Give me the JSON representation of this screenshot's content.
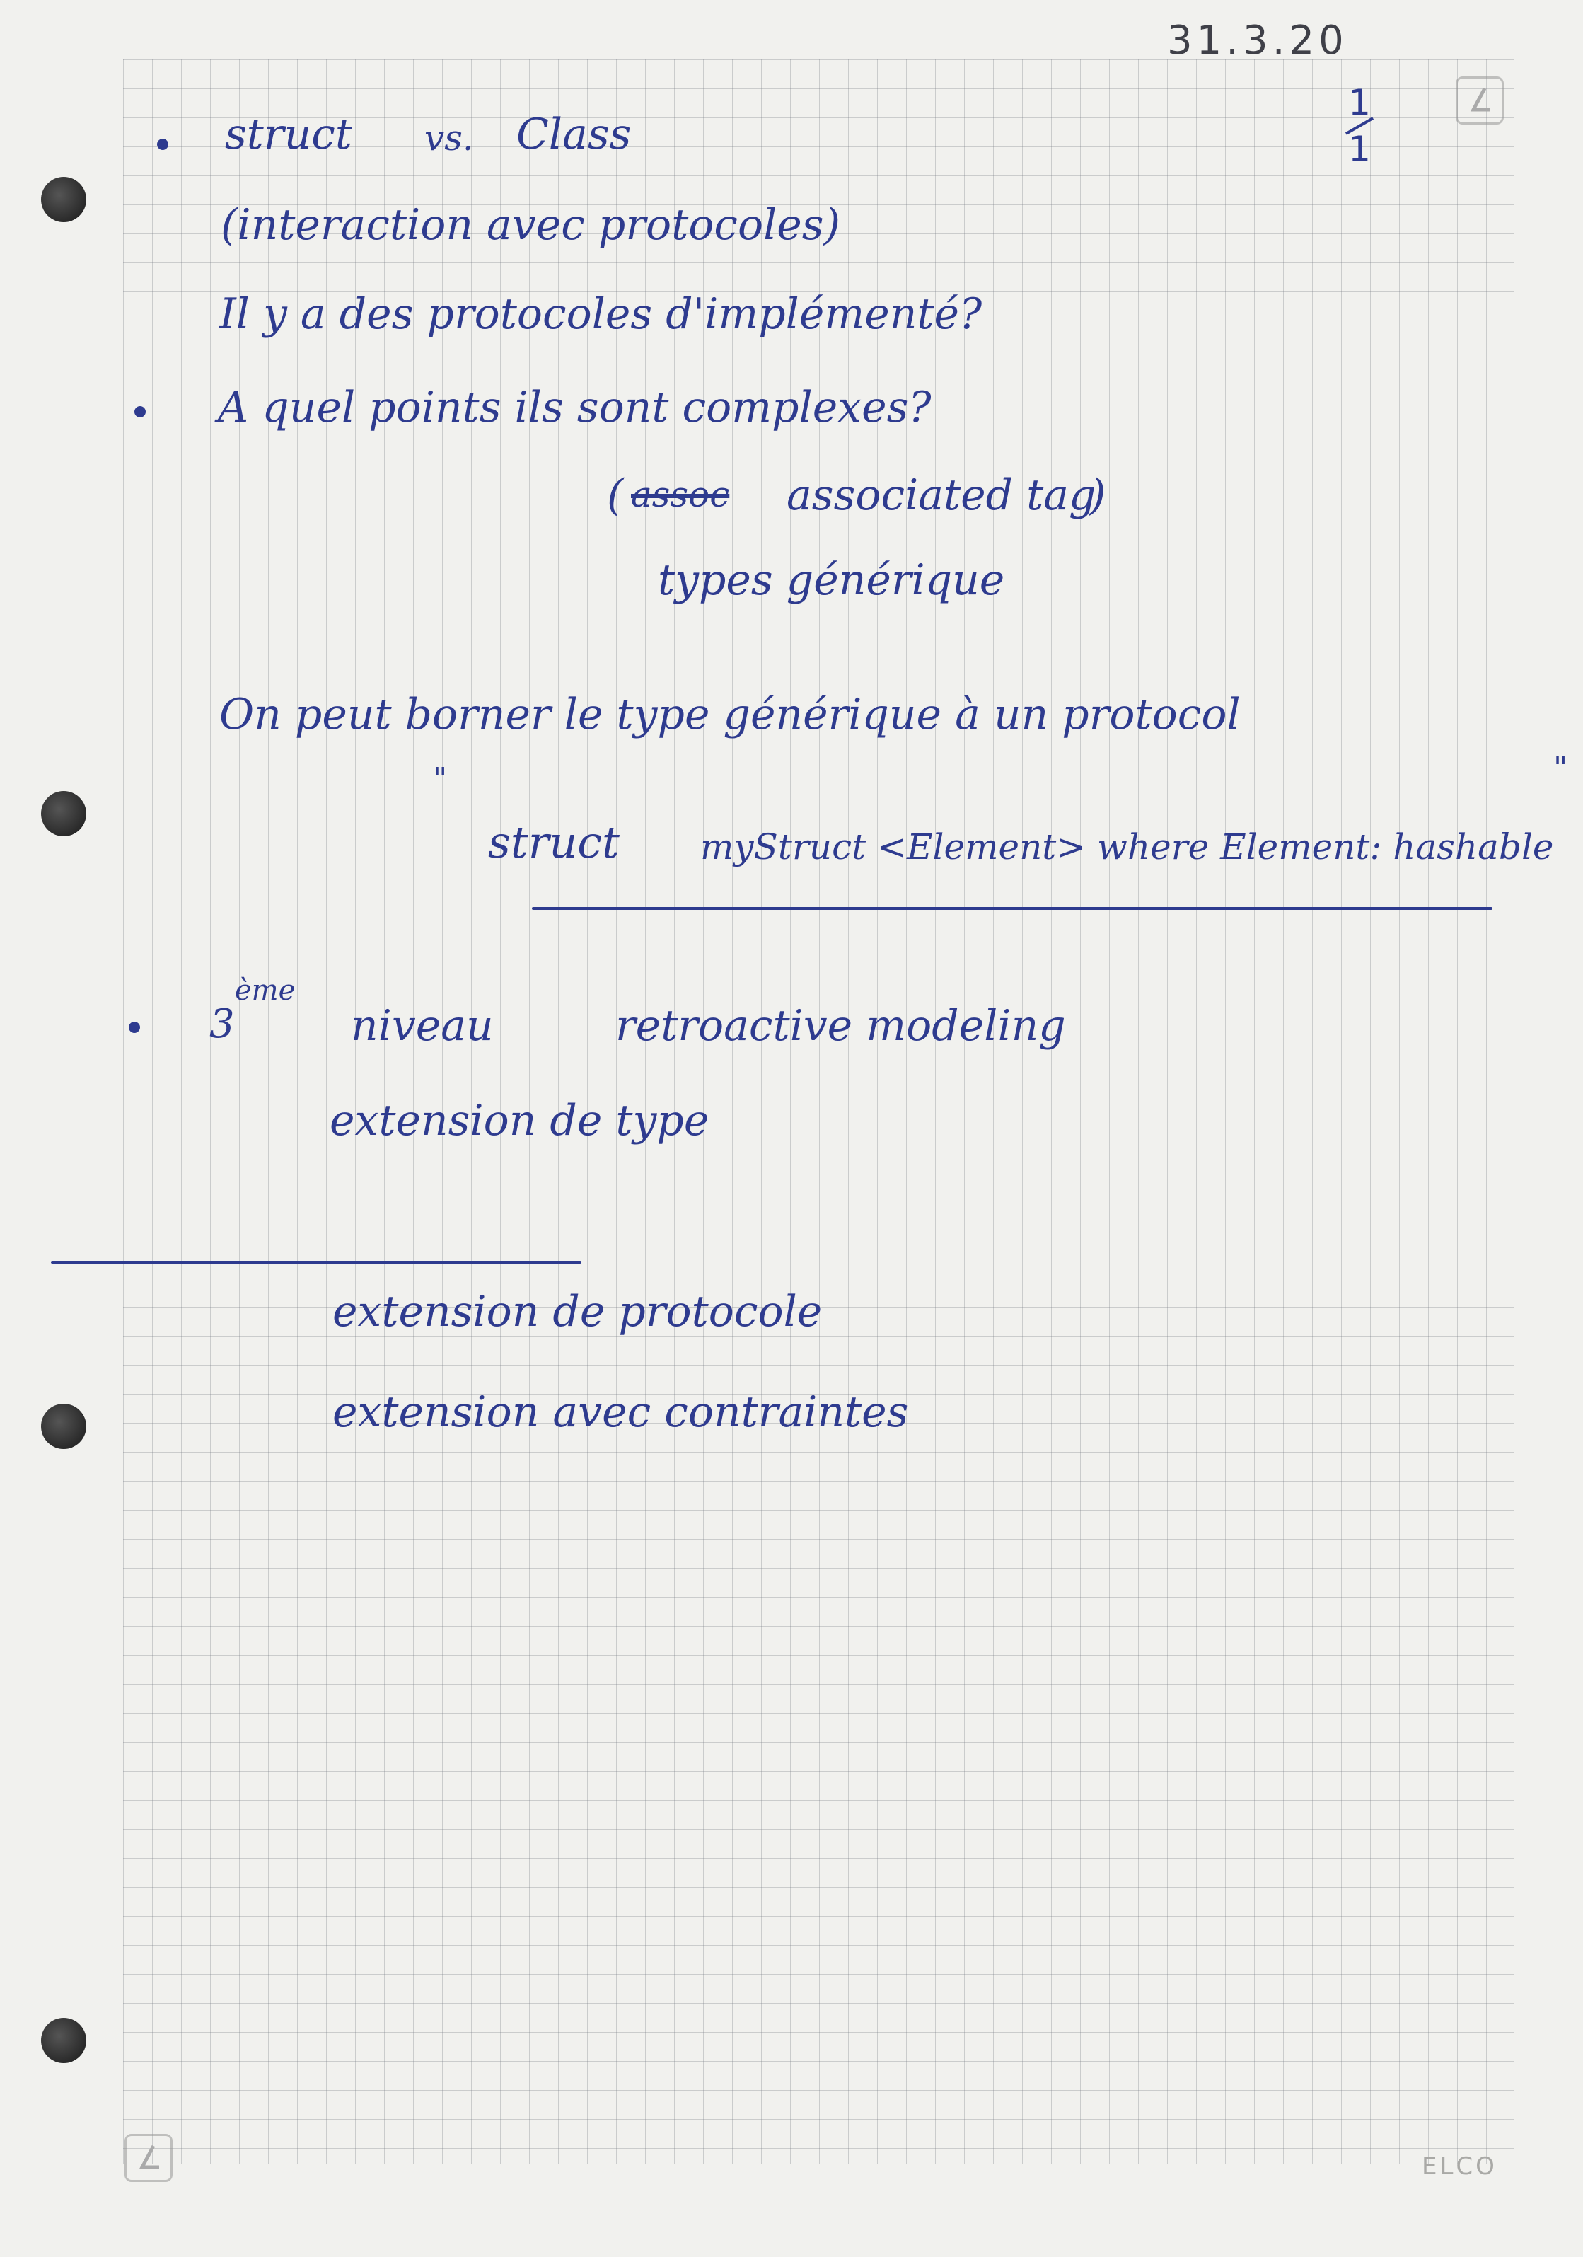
{
  "header": {
    "date": "31.3.20",
    "page_number": "1",
    "page_total": "1"
  },
  "notes": {
    "line1_struct": "struct",
    "line1_vs": "vs.",
    "line1_class": "Class",
    "line2": "(interaction avec protocoles)",
    "line3": "Il y a des protocoles d'implémenté?",
    "line4": "A quel points ils sont complexes?",
    "line5_struck": "assoc",
    "line5_open": "(",
    "line5_text": "associated tag",
    "line5_close": ")",
    "line6": "types générique",
    "line7": "On peut borner le type générique à un protocol",
    "ditto_left": "\"",
    "ditto_right": "\"",
    "line8_keyword": "struct",
    "line8_code": "myStruct <Element> where Element: hashable",
    "line9_level_num": "3",
    "line9_level_sup": "ème",
    "line9_niveau": "niveau",
    "line9_term": "retroactive modeling",
    "line10": "extension de type",
    "line11": "extension de protocole",
    "line12": "extension avec contraintes"
  },
  "footer": {
    "brand": "ELCO"
  },
  "colors": {
    "ink": "#2e3b8f",
    "paper": "#f1f1ee",
    "grid": "#787d87"
  }
}
